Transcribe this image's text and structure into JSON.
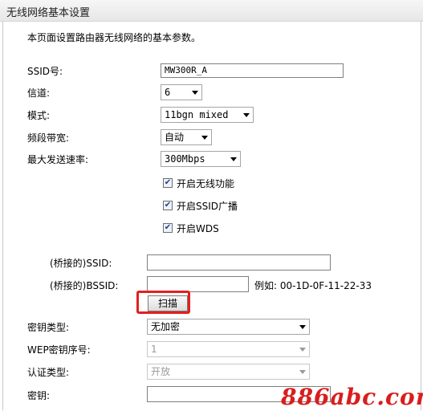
{
  "header": {
    "title": "无线网络基本设置"
  },
  "intro": "本页面设置路由器无线网络的基本参数。",
  "ssid": {
    "label": "SSID号:",
    "value": "MW300R_A"
  },
  "channel": {
    "label": "信道:",
    "value": "6"
  },
  "mode": {
    "label": "模式:",
    "value": "11bgn mixed"
  },
  "bandwidth": {
    "label": "频段带宽:",
    "value": "自动"
  },
  "max_rate": {
    "label": "最大发送速率:",
    "value": "300Mbps"
  },
  "options": [
    {
      "label": "开启无线功能",
      "checked": true
    },
    {
      "label": "开启SSID广播",
      "checked": true
    },
    {
      "label": "开启WDS",
      "checked": true
    }
  ],
  "bridge_ssid": {
    "label": "(桥接的)SSID:",
    "value": ""
  },
  "bridge_bssid": {
    "label": "(桥接的)BSSID:",
    "value": "",
    "example": "例如: 00-1D-0F-11-22-33"
  },
  "scan_button": "扫描",
  "key_type": {
    "label": "密钥类型:",
    "value": "无加密"
  },
  "wep_index": {
    "label": "WEP密钥序号:",
    "value": "1"
  },
  "auth_type": {
    "label": "认证类型:",
    "value": "开放"
  },
  "key": {
    "label": "密钥:",
    "value": ""
  },
  "watermark": "886abc.com",
  "colors": {
    "watermark": "#d81e1e",
    "highlight": "#e02020"
  }
}
